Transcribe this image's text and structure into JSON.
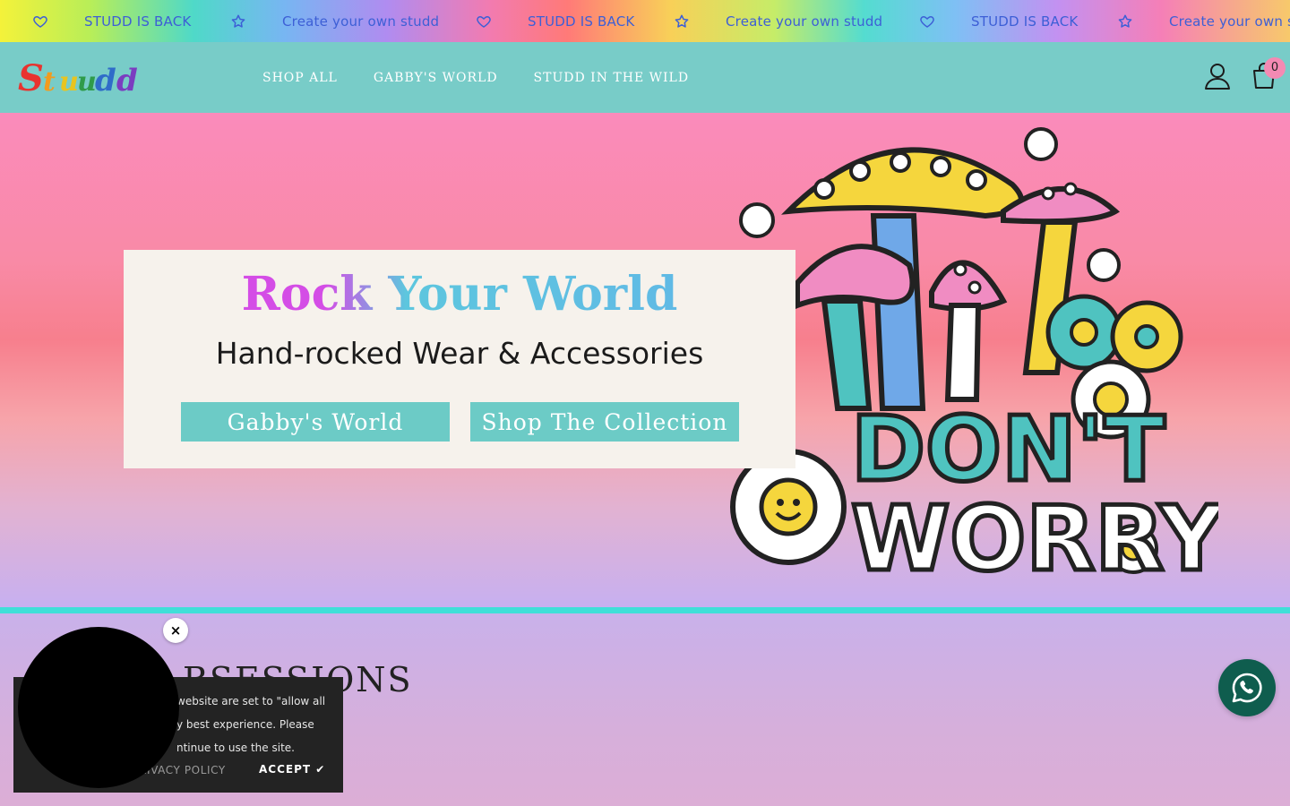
{
  "announcement": {
    "items": [
      {
        "icon": "heart-icon",
        "text": "STUDD IS BACK",
        "color": "#3d5fd6"
      },
      {
        "icon": "star-icon",
        "text": "Create your own studd",
        "color": "#3d5fd6"
      },
      {
        "icon": "heart-icon",
        "text": "STUDD IS BACK",
        "color": "#3d5fd6"
      },
      {
        "icon": "star-icon",
        "text": "Create your own studd",
        "color": "#3d5fd6"
      },
      {
        "icon": "heart-icon",
        "text": "STUDD IS BACK",
        "color": "#3d5fd6"
      },
      {
        "icon": "star-icon",
        "text": "Create your own s",
        "color": "#3d5fd6"
      }
    ]
  },
  "header": {
    "logo_text": "Studd",
    "nav": [
      "SHOP ALL",
      "GABBY'S WORLD",
      "STUDD IN THE WILD"
    ],
    "cart_count": "0",
    "colors": {
      "background": "#78ccc8",
      "badge": "#f48ab3"
    }
  },
  "hero": {
    "title": "Rock Your World",
    "subtitle": "Hand-rocked Wear & Accessories",
    "buttons": [
      "Gabby's World",
      "Shop The Collection"
    ],
    "art_text": [
      "DON'T",
      "WORRY"
    ],
    "colors": {
      "button": "#6ccbc6",
      "card": "#f6f2ec",
      "divider": "#40dfd8"
    }
  },
  "section": {
    "heading_visible_fragment": "BSESSIONS"
  },
  "cookie_banner": {
    "lines": [
      "website are set to \"allow all",
      "y best experience. Please",
      "ntinue to use the site."
    ],
    "privacy_label": "RIVACY POLICY",
    "accept_label": "ACCEPT ✔"
  },
  "bubble": {
    "close_label": "×"
  },
  "whatsapp": {
    "icon": "whatsapp-icon",
    "color": "#0f5d4e"
  }
}
